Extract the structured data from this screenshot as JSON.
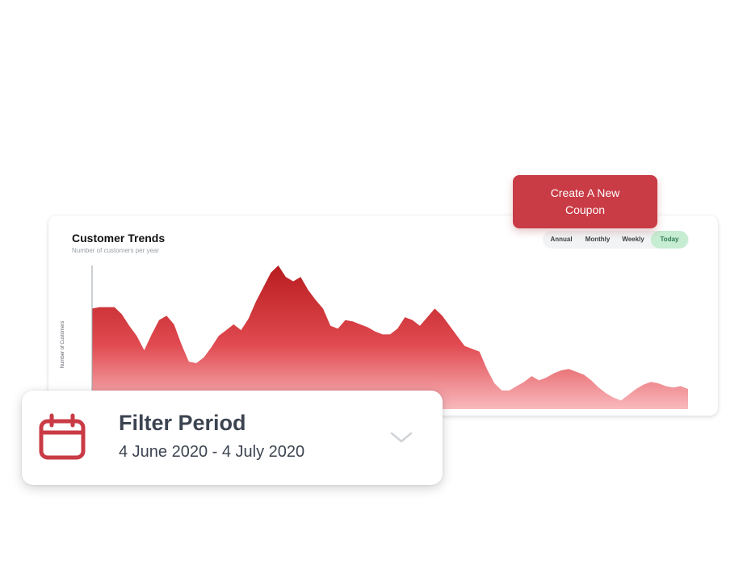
{
  "coupon_button": {
    "label": "Create A New Coupon"
  },
  "trends_card": {
    "title": "Customer Trends",
    "subtitle": "Number of customers per year",
    "tabs": [
      {
        "label": "Annual",
        "active": false
      },
      {
        "label": "Monthly",
        "active": false
      },
      {
        "label": "Weekly",
        "active": false
      },
      {
        "label": "Today",
        "active": true
      }
    ]
  },
  "filter": {
    "title": "Filter Period",
    "range": "4 June 2020 - 4 July 2020",
    "icons": {
      "calendar": "calendar-icon",
      "dropdown": "chevron-down-icon"
    }
  },
  "colors": {
    "accent": "#c93b45",
    "area_top": "#b81c1f",
    "area_bottom": "#f9b9bd",
    "active_tab": "#c6ecd2",
    "text_dark": "#3c4451"
  },
  "chart_data": {
    "type": "area",
    "title": "Customer Trends",
    "subtitle": "Number of customers per year",
    "xlabel": "",
    "ylabel": "Number of Customers",
    "ylim": [
      0,
      100
    ],
    "grid": false,
    "legend": "none",
    "x": [
      0,
      1,
      2,
      3,
      4,
      5,
      6,
      7,
      8,
      9,
      10,
      11,
      12,
      13,
      14,
      15,
      16,
      17,
      18,
      19,
      20,
      21,
      22,
      23,
      24,
      25,
      26,
      27,
      28,
      29,
      30,
      31,
      32,
      33,
      34,
      35,
      36,
      37,
      38,
      39,
      40,
      41,
      42,
      43,
      44,
      45,
      46,
      47,
      48,
      49,
      50,
      51,
      52,
      53,
      54,
      55,
      56,
      57,
      58,
      59,
      60,
      61,
      62,
      63,
      64,
      65,
      66,
      67,
      68,
      69,
      70,
      71,
      72,
      73,
      74,
      75,
      76,
      77,
      78,
      79,
      80
    ],
    "values": [
      70,
      71,
      71,
      71,
      66,
      58,
      51,
      41,
      52,
      62,
      65,
      59,
      45,
      33,
      32,
      36,
      43,
      51,
      55,
      59,
      55,
      63,
      75,
      85,
      95,
      100,
      92,
      89,
      92,
      83,
      76,
      70,
      58,
      56,
      62,
      61,
      59,
      57,
      54,
      52,
      52,
      56,
      64,
      62,
      58,
      64,
      70,
      65,
      58,
      51,
      44,
      42,
      40,
      28,
      18,
      13,
      13,
      16,
      19,
      23,
      20,
      22,
      25,
      27,
      28,
      26,
      24,
      20,
      15,
      11,
      8,
      6,
      10,
      14,
      17,
      19,
      18,
      16,
      15,
      16,
      14
    ]
  }
}
